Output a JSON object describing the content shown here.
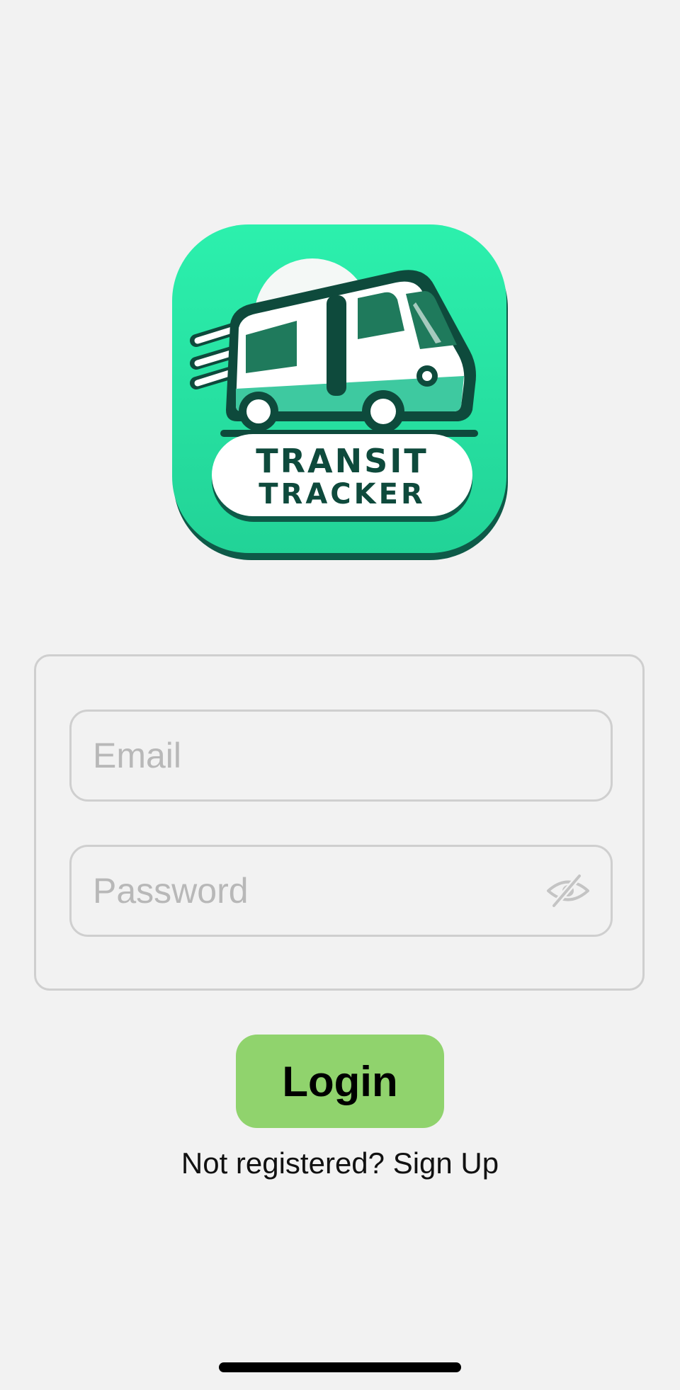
{
  "app": {
    "name": "Transit Tracker",
    "logo_line1": "TRANSIT",
    "logo_line2": "TRACKER"
  },
  "form": {
    "email": {
      "placeholder": "Email",
      "value": ""
    },
    "password": {
      "placeholder": "Password",
      "value": "",
      "toggle_icon": "eye-off-icon"
    }
  },
  "login_button": {
    "label": "Login"
  },
  "signup_prompt": {
    "text": "Not registered? Sign Up"
  },
  "colors": {
    "background": "#f2f2f2",
    "logo_green": "#2ee2a5",
    "logo_dark": "#0e4a3c",
    "login_button": "#90d36d",
    "border": "#cfcfcf",
    "placeholder": "#b8b8b8"
  }
}
